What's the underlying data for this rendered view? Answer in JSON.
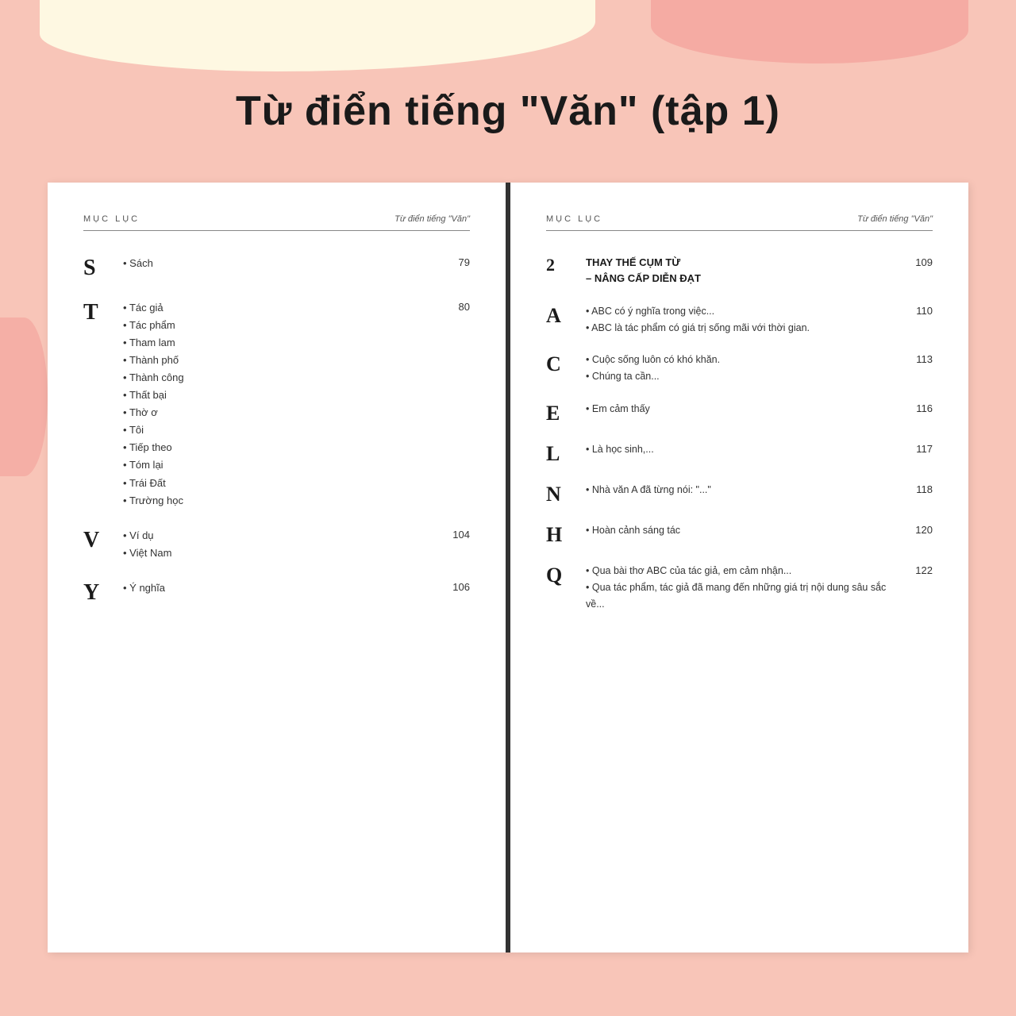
{
  "background_color": "#f8c5b8",
  "title": "Từ điển tiếng \"Văn\" (tập 1)",
  "left_page": {
    "header_label": "MỤC LỤC",
    "header_title": "Từ điển tiếng \"Văn\"",
    "entries": [
      {
        "letter": "S",
        "items": [
          "Sách"
        ],
        "page": "79"
      },
      {
        "letter": "T",
        "items": [
          "Tác giả",
          "Tác phẩm",
          "Tham lam",
          "Thành phố",
          "Thành công",
          "Thất bại",
          "Thờ ơ",
          "Tôi",
          "Tiếp theo",
          "Tóm lại",
          "Trái Đất",
          "Trường học"
        ],
        "page": "80"
      },
      {
        "letter": "V",
        "items": [
          "Ví dụ",
          "Việt Nam"
        ],
        "page": "104"
      },
      {
        "letter": "Y",
        "items": [
          "Ý nghĩa"
        ],
        "page": "106"
      }
    ]
  },
  "right_page": {
    "header_label": "MỤC LỤC",
    "header_title": "Từ điển tiếng \"Văn\"",
    "section": {
      "num": "2",
      "title": "THAY THẾ CỤM TỪ\n– NÂNG CẤP DIỄN ĐẠT",
      "page": "109"
    },
    "entries": [
      {
        "letter": "A",
        "items": [
          "ABC có ý nghĩa trong việc...",
          "ABC là tác phẩm có giá trị sống mãi với thời gian."
        ],
        "page": "110"
      },
      {
        "letter": "C",
        "items": [
          "Cuộc sống luôn có khó khăn.",
          "Chúng ta cần..."
        ],
        "page": "113"
      },
      {
        "letter": "E",
        "items": [
          "Em cảm thấy"
        ],
        "page": "116"
      },
      {
        "letter": "L",
        "items": [
          "Là học sinh,..."
        ],
        "page": "117"
      },
      {
        "letter": "N",
        "items": [
          "Nhà văn A đã từng nói: \"...\""
        ],
        "page": "118"
      },
      {
        "letter": "H",
        "items": [
          "Hoàn cảnh sáng tác"
        ],
        "page": "120"
      },
      {
        "letter": "Q",
        "items": [
          "Qua bài thơ ABC của tác giả, em cảm nhận...",
          "Qua tác phẩm, tác giả đã mang đến những giá trị nội dung sâu sắc về..."
        ],
        "page": "122"
      }
    ]
  }
}
